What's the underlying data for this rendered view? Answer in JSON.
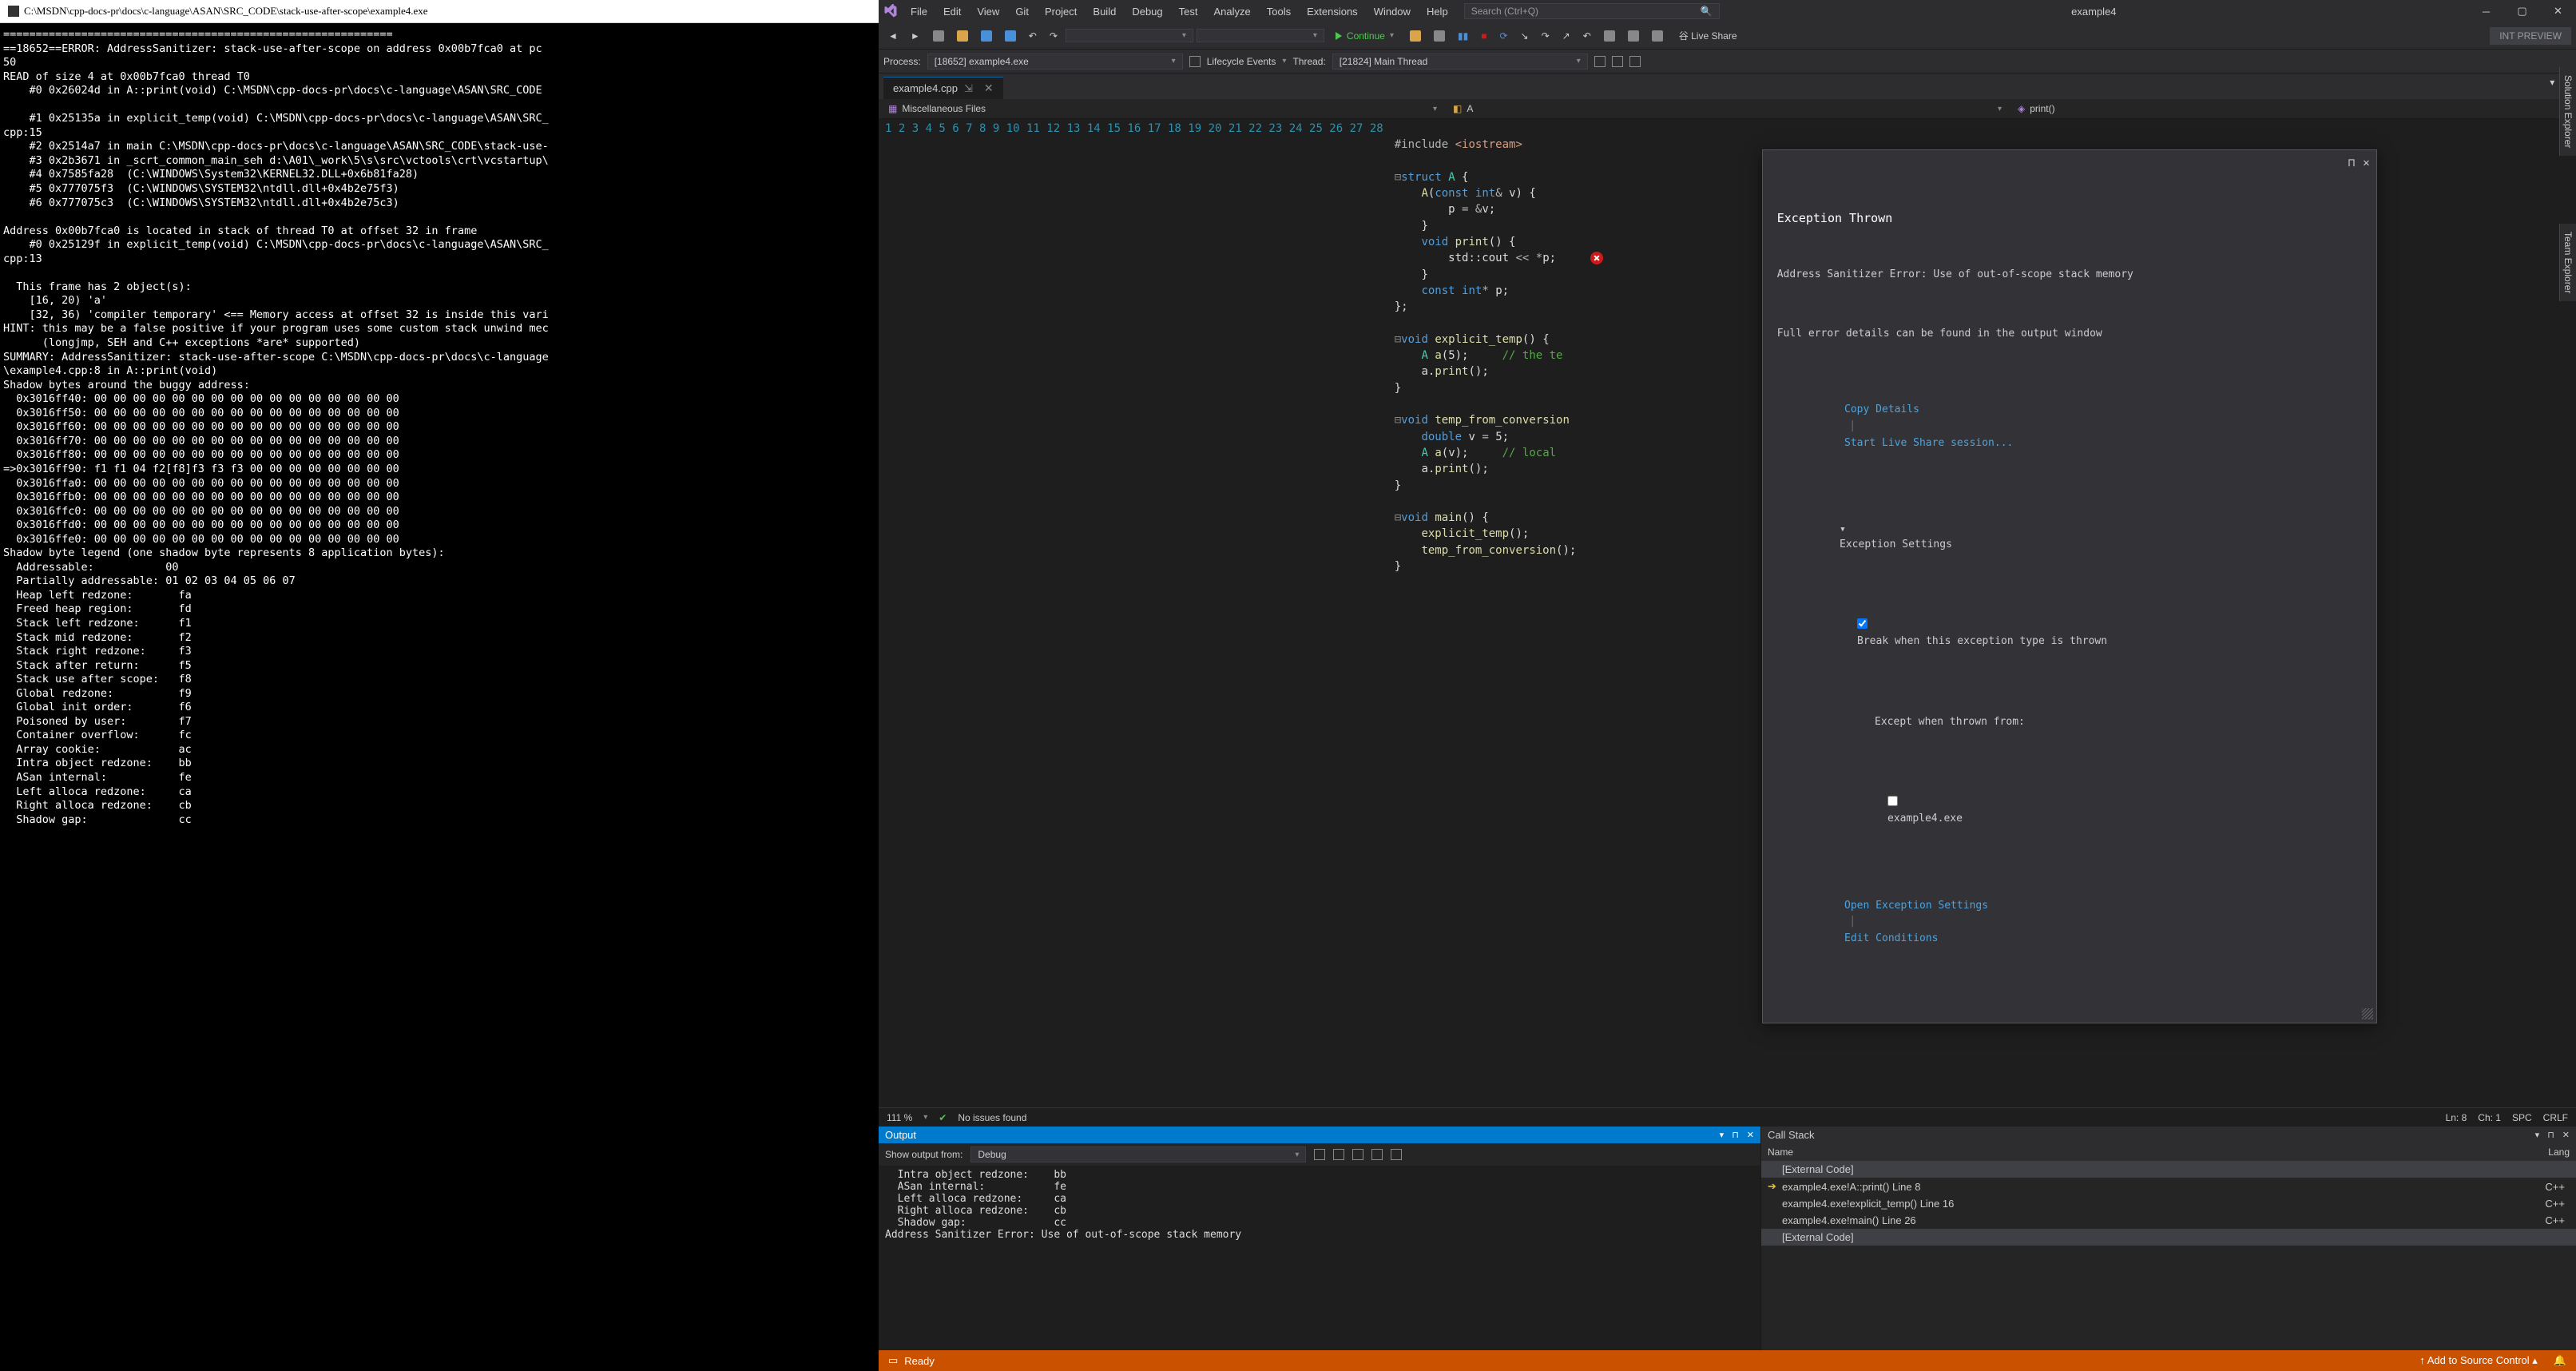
{
  "console": {
    "title": "C:\\MSDN\\cpp-docs-pr\\docs\\c-language\\ASAN\\SRC_CODE\\stack-use-after-scope\\example4.exe",
    "body": "============================================================\n==18652==ERROR: AddressSanitizer: stack-use-after-scope on address 0x00b7fca0 at pc\n50\nREAD of size 4 at 0x00b7fca0 thread T0\n    #0 0x26024d in A::print(void) C:\\MSDN\\cpp-docs-pr\\docs\\c-language\\ASAN\\SRC_CODE\n\n    #1 0x25135a in explicit_temp(void) C:\\MSDN\\cpp-docs-pr\\docs\\c-language\\ASAN\\SRC_\ncpp:15\n    #2 0x2514a7 in main C:\\MSDN\\cpp-docs-pr\\docs\\c-language\\ASAN\\SRC_CODE\\stack-use-\n    #3 0x2b3671 in _scrt_common_main_seh d:\\A01\\_work\\5\\s\\src\\vctools\\crt\\vcstartup\\\n    #4 0x7585fa28  (C:\\WINDOWS\\System32\\KERNEL32.DLL+0x6b81fa28)\n    #5 0x777075f3  (C:\\WINDOWS\\SYSTEM32\\ntdll.dll+0x4b2e75f3)\n    #6 0x777075c3  (C:\\WINDOWS\\SYSTEM32\\ntdll.dll+0x4b2e75c3)\n\nAddress 0x00b7fca0 is located in stack of thread T0 at offset 32 in frame\n    #0 0x25129f in explicit_temp(void) C:\\MSDN\\cpp-docs-pr\\docs\\c-language\\ASAN\\SRC_\ncpp:13\n\n  This frame has 2 object(s):\n    [16, 20) 'a'\n    [32, 36) 'compiler temporary' <== Memory access at offset 32 is inside this vari\nHINT: this may be a false positive if your program uses some custom stack unwind mec\n      (longjmp, SEH and C++ exceptions *are* supported)\nSUMMARY: AddressSanitizer: stack-use-after-scope C:\\MSDN\\cpp-docs-pr\\docs\\c-language\n\\example4.cpp:8 in A::print(void)\nShadow bytes around the buggy address:\n  0x3016ff40: 00 00 00 00 00 00 00 00 00 00 00 00 00 00 00 00\n  0x3016ff50: 00 00 00 00 00 00 00 00 00 00 00 00 00 00 00 00\n  0x3016ff60: 00 00 00 00 00 00 00 00 00 00 00 00 00 00 00 00\n  0x3016ff70: 00 00 00 00 00 00 00 00 00 00 00 00 00 00 00 00\n  0x3016ff80: 00 00 00 00 00 00 00 00 00 00 00 00 00 00 00 00\n=>0x3016ff90: f1 f1 04 f2[f8]f3 f3 f3 00 00 00 00 00 00 00 00\n  0x3016ffa0: 00 00 00 00 00 00 00 00 00 00 00 00 00 00 00 00\n  0x3016ffb0: 00 00 00 00 00 00 00 00 00 00 00 00 00 00 00 00\n  0x3016ffc0: 00 00 00 00 00 00 00 00 00 00 00 00 00 00 00 00\n  0x3016ffd0: 00 00 00 00 00 00 00 00 00 00 00 00 00 00 00 00\n  0x3016ffe0: 00 00 00 00 00 00 00 00 00 00 00 00 00 00 00 00\nShadow byte legend (one shadow byte represents 8 application bytes):\n  Addressable:           00\n  Partially addressable: 01 02 03 04 05 06 07\n  Heap left redzone:       fa\n  Freed heap region:       fd\n  Stack left redzone:      f1\n  Stack mid redzone:       f2\n  Stack right redzone:     f3\n  Stack after return:      f5\n  Stack use after scope:   f8\n  Global redzone:          f9\n  Global init order:       f6\n  Poisoned by user:        f7\n  Container overflow:      fc\n  Array cookie:            ac\n  Intra object redzone:    bb\n  ASan internal:           fe\n  Left alloca redzone:     ca\n  Right alloca redzone:    cb\n  Shadow gap:              cc"
  },
  "menu": [
    "File",
    "Edit",
    "View",
    "Git",
    "Project",
    "Build",
    "Debug",
    "Test",
    "Analyze",
    "Tools",
    "Extensions",
    "Window",
    "Help"
  ],
  "search_placeholder": "Search (Ctrl+Q)",
  "solution": "example4",
  "continue_label": "Continue",
  "live_share": "Live Share",
  "int_preview": "INT PREVIEW",
  "process_label": "Process:",
  "process_value": "[18652] example4.exe",
  "lifecycle": "Lifecycle Events",
  "thread_label": "Thread:",
  "thread_value": "[21824] Main Thread",
  "tab": "example4.cpp",
  "nav1": "Miscellaneous Files",
  "nav2": "A",
  "nav3": "print()",
  "zoom": "111 %",
  "issues": "No issues found",
  "ln": "Ln: 8",
  "ch": "Ch: 1",
  "spc": "SPC",
  "crlf": "CRLF",
  "exception": {
    "title": "Exception Thrown",
    "message": "Address Sanitizer Error: Use of out-of-scope stack memory",
    "detail": "Full error details can be found in the output window",
    "copy": "Copy Details",
    "liveshare": "Start Live Share session...",
    "settings_header": "Exception Settings",
    "break_label": "Break when this exception type is thrown",
    "except_label": "Except when thrown from:",
    "except_item": "example4.exe",
    "open_settings": "Open Exception Settings",
    "edit_cond": "Edit Conditions"
  },
  "output": {
    "title": "Output",
    "show_label": "Show output from:",
    "show_value": "Debug",
    "body": "  Intra object redzone:    bb\n  ASan internal:           fe\n  Left alloca redzone:     ca\n  Right alloca redzone:    cb\n  Shadow gap:              cc\nAddress Sanitizer Error: Use of out-of-scope stack memory"
  },
  "callstack": {
    "title": "Call Stack",
    "col_name": "Name",
    "col_lang": "Lang",
    "rows": [
      {
        "name": "[External Code]",
        "lang": "",
        "current": false,
        "ext": true
      },
      {
        "name": "example4.exe!A::print() Line 8",
        "lang": "C++",
        "current": true
      },
      {
        "name": "example4.exe!explicit_temp() Line 16",
        "lang": "C++"
      },
      {
        "name": "example4.exe!main() Line 26",
        "lang": "C++"
      },
      {
        "name": "[External Code]",
        "lang": "",
        "ext": true
      }
    ]
  },
  "statusbar": {
    "ready": "Ready",
    "add_src": "Add to Source Control"
  },
  "vtabs": [
    "Solution Explorer",
    "Team Explorer"
  ],
  "code_lines": 28
}
